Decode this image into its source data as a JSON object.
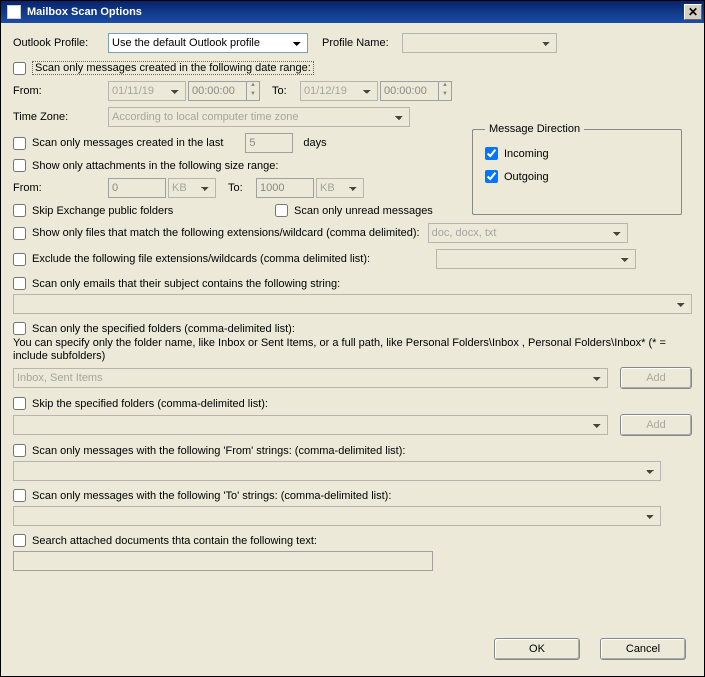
{
  "title": "Mailbox Scan Options",
  "labels": {
    "outlook_profile": "Outlook Profile:",
    "profile_name": "Profile Name:",
    "default_profile": "Use the default Outlook profile",
    "date_range_chk": "Scan only messages created in the following date range:",
    "from": "From:",
    "to": "To:",
    "date_from": "01/11/19",
    "time_from": "00:00:00",
    "date_to": "01/12/19",
    "time_to": "00:00:00",
    "timezone": "Time Zone:",
    "timezone_text": "According to local computer time zone",
    "last_chk": "Scan only messages created in the last",
    "last_val": "5",
    "days": "days",
    "size_chk": "Show only attachments in the following size range:",
    "size_from": "0",
    "size_to": "1000",
    "kb": "KB",
    "msg_dir": "Message Direction",
    "incoming": "Incoming",
    "outgoing": "Outgoing",
    "skip_exch": "Skip Exchange public folders",
    "unread": "Scan only unread messages",
    "ext_show": "Show only files that match the following extensions/wildcard (comma delimited):",
    "ext_placeholder": "doc, docx, txt",
    "ext_excl": "Exclude the following file extensions/wildcards (comma delimited list):",
    "subj": "Scan only emails that their subject contains the following string:",
    "folders": "Scan only the specified folders (comma-delimited list):",
    "folders_hint": "You can specify only the folder name, like Inbox or Sent Items, or a full path, like Personal Folders\\Inbox , Personal Folders\\Inbox* (* = include subfolders)",
    "folders_placeholder": "Inbox, Sent Items",
    "add": "Add",
    "skip_folders": "Skip the specified folders (comma-delimited list):",
    "from_str": "Scan only messages with the following 'From' strings: (comma-delimited list):",
    "to_str": "Scan only messages with the following 'To' strings: (comma-delimited list):",
    "attach_text": "Search attached documents thta contain the following text:",
    "ok": "OK",
    "cancel": "Cancel"
  }
}
